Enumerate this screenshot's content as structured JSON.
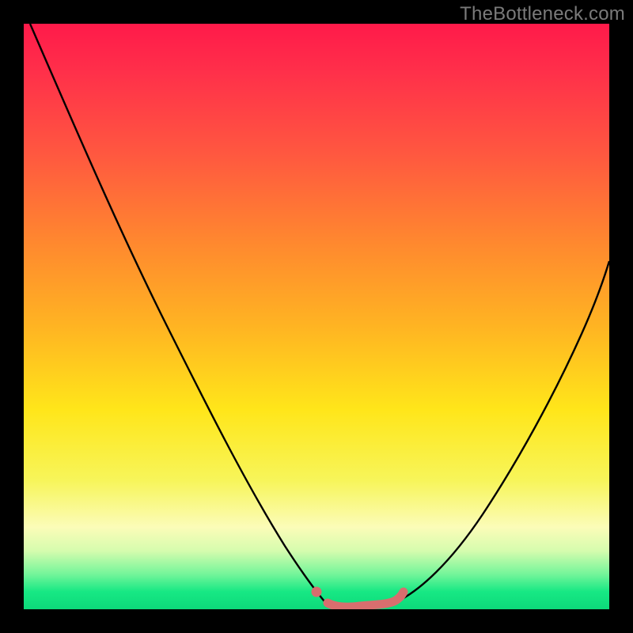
{
  "watermark": "TheBottleneck.com",
  "chart_data": {
    "type": "line",
    "title": "",
    "xlabel": "",
    "ylabel": "",
    "xlim": [
      0,
      100
    ],
    "ylim": [
      0,
      100
    ],
    "grid": false,
    "series": [
      {
        "name": "left-curve",
        "x": [
          1,
          7,
          13,
          19,
          25,
          31,
          37,
          42,
          46,
          49,
          51
        ],
        "values": [
          100,
          86,
          72,
          59,
          46,
          34,
          23,
          13,
          6,
          2,
          0
        ]
      },
      {
        "name": "right-curve",
        "x": [
          63,
          67,
          72,
          78,
          84,
          90,
          95,
          100
        ],
        "values": [
          0,
          3,
          8,
          16,
          26,
          38,
          50,
          63
        ]
      },
      {
        "name": "flat-segment",
        "x": [
          51,
          55,
          59,
          63
        ],
        "values": [
          0,
          0,
          0,
          0
        ]
      }
    ],
    "annotations": [
      {
        "name": "pink-dot",
        "x": 50,
        "y": 2
      },
      {
        "name": "pink-squiggle-start",
        "x": 52,
        "y": 0
      },
      {
        "name": "pink-squiggle-end",
        "x": 64,
        "y": 1
      }
    ],
    "colors": {
      "curve": "#000000",
      "marker": "#d86e6e",
      "gradient_top": "#ff1a4a",
      "gradient_bottom": "#0dd97a"
    }
  }
}
